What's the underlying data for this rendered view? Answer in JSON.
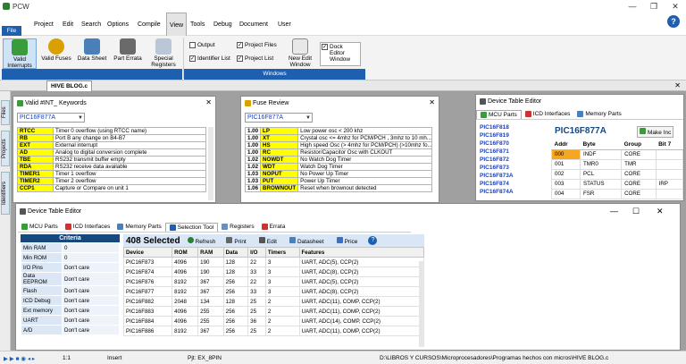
{
  "app": {
    "title": "PCW",
    "doc_tab": "HIVE BLOG.c"
  },
  "menu": [
    "File",
    "Project",
    "Edit",
    "Search",
    "Options",
    "Compile",
    "View",
    "Tools",
    "Debug",
    "Document",
    "User"
  ],
  "ribbon": {
    "buttons": [
      "Valid Interrupts",
      "Valid Fuses",
      "Data Sheet",
      "Part Errata",
      "Special Registers",
      "New Edit Window"
    ],
    "checks": [
      {
        "label": "Output",
        "checked": false
      },
      {
        "label": "Project Files",
        "checked": true
      },
      {
        "label": "Identifier List",
        "checked": true
      },
      {
        "label": "Project List",
        "checked": true
      },
      {
        "label": "Dock Editor Window",
        "checked": true
      }
    ],
    "groups": [
      "Windows"
    ]
  },
  "side_tabs": [
    "Files",
    "Projects",
    "Identifiers"
  ],
  "interrupts": {
    "title": "Valid #INT_ Keywords",
    "part": "PIC16F877A",
    "rows": [
      [
        "RTCC",
        "Timer 0 overflow (using RTCC name)"
      ],
      [
        "RB",
        "Port B any change on B4-B7"
      ],
      [
        "EXT",
        "External interrupt"
      ],
      [
        "AD",
        "Analog to digital conversion complete"
      ],
      [
        "TBE",
        "RS232 transmit buffer empty"
      ],
      [
        "RDA",
        "RS232 receive data available"
      ],
      [
        "TIMER1",
        "Timer 1 overflow"
      ],
      [
        "TIMER2",
        "Timer 2 overflow"
      ],
      [
        "CCP1",
        "Capture or Compare on unit 1"
      ]
    ]
  },
  "fuses": {
    "title": "Fuse Review",
    "part": "PIC16F877A",
    "rows": [
      [
        "1.00",
        "LP",
        "Low power osc < 200 khz"
      ],
      [
        "1.00",
        "XT",
        "Crystal osc <= 4mhz for PCM/PCH , 3mhz to 10 mh..."
      ],
      [
        "1.00",
        "HS",
        "High speed Osc (> 4mhz for PCM/PCH) (>10mhz fo..."
      ],
      [
        "1.00",
        "RC",
        "Resistor/Capacitor Osc with CLKOUT"
      ],
      [
        "1.02",
        "NOWDT",
        "No Watch Dog Timer"
      ],
      [
        "1.02",
        "WDT",
        "Watch Dog Timer"
      ],
      [
        "1.03",
        "NOPUT",
        "No Power Up Timer"
      ],
      [
        "1.03",
        "PUT",
        "Power Up Timer"
      ],
      [
        "1.06",
        "BROWNOUT",
        "Reset when brownout detected"
      ]
    ]
  },
  "dte_small": {
    "title": "Device Table Editor",
    "tabs": [
      "MCU Parts",
      "ICD Interfaces",
      "Memory Parts"
    ],
    "parts": [
      "PIC16F818",
      "PIC16F819",
      "PIC16F870",
      "PIC16F871",
      "PIC16F872",
      "PIC16F873",
      "PIC16F873A",
      "PIC16F874",
      "PIC16F874A"
    ],
    "selected": "PIC16F877A",
    "make_inc": "Make Inc",
    "cols": [
      "Addr",
      "Byte",
      "Group",
      "Bit 7"
    ],
    "rows": [
      [
        "000",
        "INDF",
        "CORE",
        ""
      ],
      [
        "001",
        "TMR0",
        "TMR",
        ""
      ],
      [
        "002",
        "PCL",
        "CORE",
        ""
      ],
      [
        "003",
        "STATUS",
        "CORE",
        "IRP"
      ],
      [
        "004",
        "FSR",
        "CORE",
        ""
      ]
    ]
  },
  "dte_main": {
    "title": "Device Table Editor",
    "tabs": [
      "MCU Parts",
      "ICD Interfaces",
      "Memory Parts",
      "Selection Tool",
      "Registers",
      "Errata"
    ],
    "criteria_title": "Criteria",
    "criteria": [
      [
        "Min RAM",
        "0"
      ],
      [
        "Min ROM",
        "0"
      ],
      [
        "I/O Pins",
        "Don't care"
      ],
      [
        "Data EEPROM",
        "Don't care"
      ],
      [
        "Flash",
        "Don't care"
      ],
      [
        "ICD Debug",
        "Don't care"
      ],
      [
        "Ext memory",
        "Don't care"
      ],
      [
        "UART",
        "Don't care"
      ],
      [
        "A/D",
        "Don't care"
      ]
    ],
    "count": "408 Selected",
    "toolbar": [
      "Refresh",
      "Print",
      "Edit",
      "Datasheet",
      "Price"
    ],
    "cols": [
      "Device",
      "ROM",
      "RAM",
      "Data",
      "I/O",
      "Timers",
      "Features"
    ],
    "rows": [
      [
        "PIC16F873",
        "4096",
        "190",
        "128",
        "22",
        "3",
        "UART, ADC(5), CCP(2)"
      ],
      [
        "PIC16F874",
        "4096",
        "190",
        "128",
        "33",
        "3",
        "UART, ADC(8), CCP(2)"
      ],
      [
        "PIC16F876",
        "8192",
        "367",
        "256",
        "22",
        "3",
        "UART, ADC(5), CCP(2)"
      ],
      [
        "PIC16F877",
        "8192",
        "367",
        "256",
        "33",
        "3",
        "UART, ADC(8), CCP(2)"
      ],
      [
        "PIC16F882",
        "2048",
        "134",
        "128",
        "25",
        "2",
        "UART, ADC(11), COMP, CCP(2)"
      ],
      [
        "PIC16F883",
        "4096",
        "255",
        "256",
        "25",
        "2",
        "UART, ADC(11), COMP, CCP(2)"
      ],
      [
        "PIC16F884",
        "4096",
        "255",
        "256",
        "36",
        "2",
        "UART, ADC(14), COMP, CCP(2)"
      ],
      [
        "PIC16F886",
        "8192",
        "367",
        "256",
        "25",
        "2",
        "UART, ADC(11), COMP, CCP(2)"
      ]
    ]
  },
  "status": {
    "pos": "1:1",
    "mode": "Insert",
    "pjt": "Pjt: EX_8PIN",
    "path": "D:\\LIBROS Y CURSOS\\Microprocesadores\\Programas hechos con micros\\HIVE BLOG.c"
  }
}
